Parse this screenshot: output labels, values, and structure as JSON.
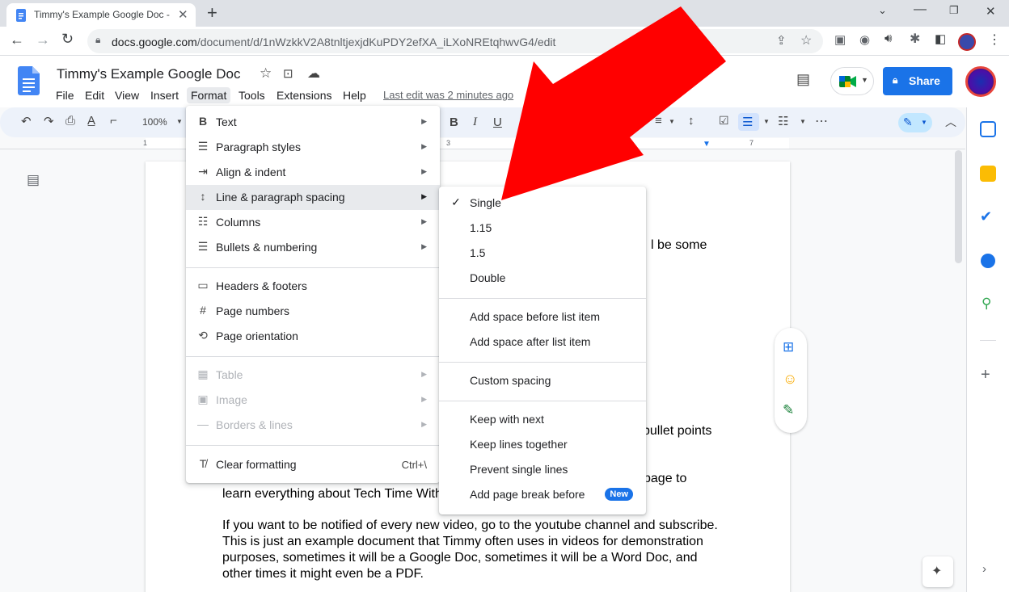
{
  "browser": {
    "tab_title": "Timmy's Example Google Doc - G",
    "url_domain": "docs.google.com",
    "url_path": "/document/d/1nWzkkV2A8tnltjexjdKuPDY2efXA_iLXoNREtqhwvG4/edit"
  },
  "doc": {
    "title": "Timmy's Example Google Doc",
    "last_edit": "Last edit was 2 minutes ago",
    "share_label": "Share",
    "zoom": "100%"
  },
  "menubar": [
    "File",
    "Edit",
    "View",
    "Insert",
    "Format",
    "Tools",
    "Extensions",
    "Help"
  ],
  "format_menu": {
    "text": "Text",
    "paragraph_styles": "Paragraph styles",
    "align_indent": "Align & indent",
    "line_spacing": "Line & paragraph spacing",
    "columns": "Columns",
    "bullets": "Bullets & numbering",
    "headers_footers": "Headers & footers",
    "page_numbers": "Page numbers",
    "page_orientation": "Page orientation",
    "table": "Table",
    "image": "Image",
    "borders_lines": "Borders & lines",
    "clear_formatting": "Clear formatting",
    "clear_shortcut": "Ctrl+\\"
  },
  "spacing_menu": {
    "single": "Single",
    "s115": "1.15",
    "s15": "1.5",
    "double": "Double",
    "add_before": "Add space before list item",
    "add_after": "Add space after list item",
    "custom": "Custom spacing",
    "keep_next": "Keep with next",
    "keep_lines": "Keep lines together",
    "prevent_single": "Prevent single lines",
    "page_break": "Add page break before",
    "new_badge": "New"
  },
  "page_text": {
    "frag1": "l be some",
    "frag2": "bullet points",
    "frag3": "page to",
    "line_learn": "learn everything about Tech Time With",
    "p1": "If you want to be notified of every new video, go to the youtube channel and subscribe.",
    "p2": "This is just an example document that Timmy often uses  in videos for demonstration",
    "p3": "purposes, sometimes it will be  a Google Doc, sometimes it will be a Word Doc, and",
    "p4": "other  times it might even be a PDF."
  },
  "ruler_marks": {
    "r1": "1",
    "r3": "3",
    "r7": "7"
  },
  "colors": {
    "accent": "#1a73e8",
    "arrow": "#ff0000",
    "menu_highlight": "#e8eaed"
  }
}
